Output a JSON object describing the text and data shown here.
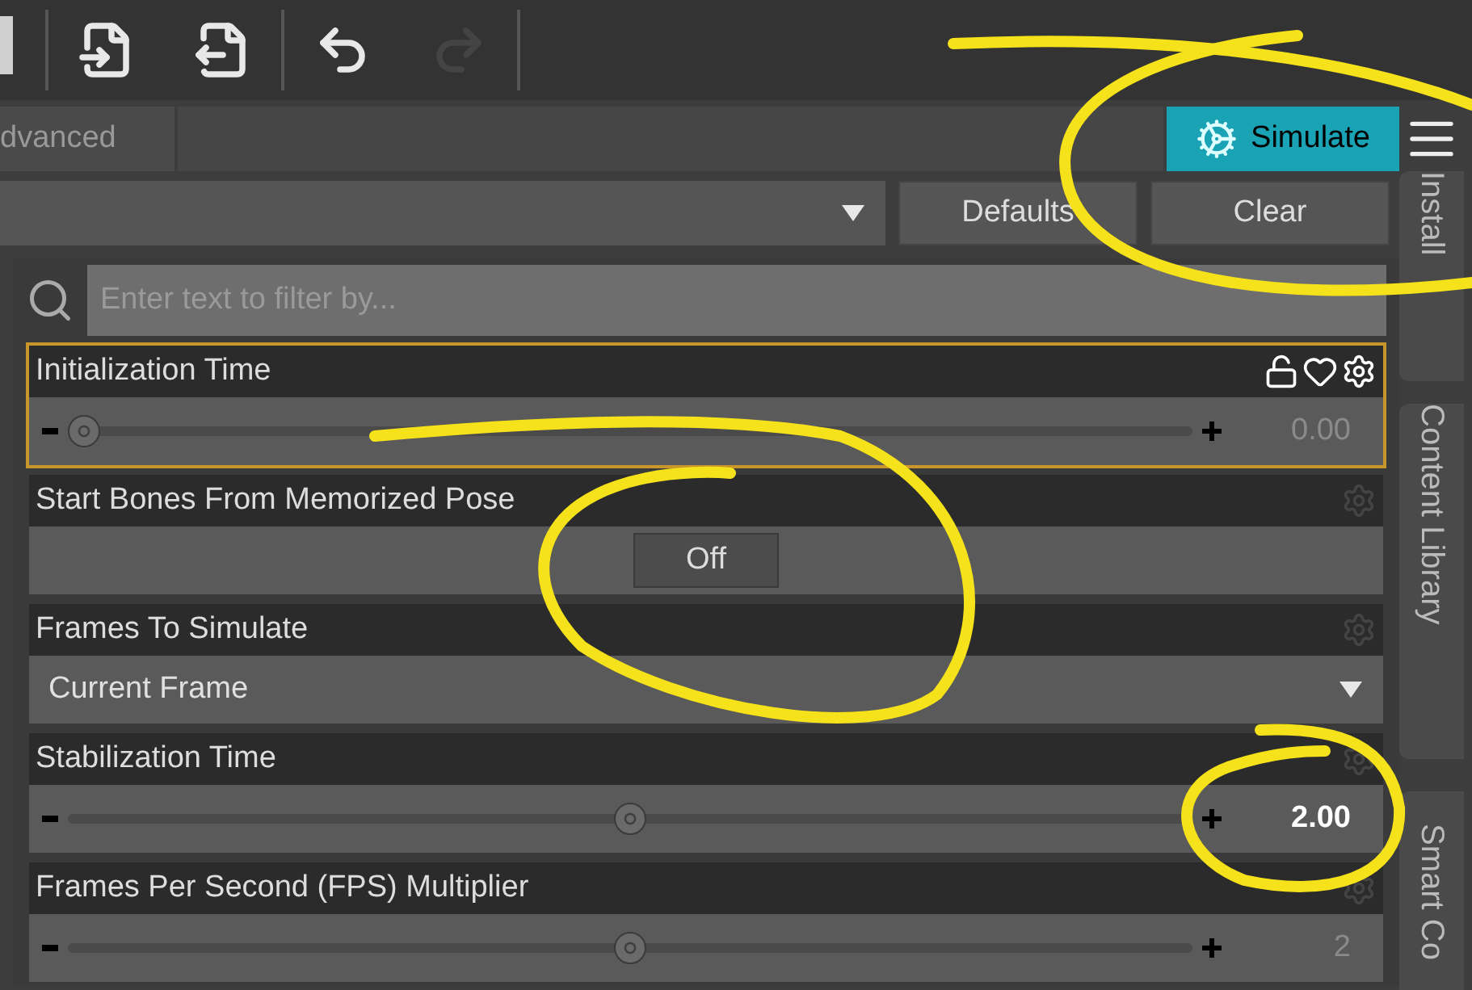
{
  "toolbar": [
    {
      "kind": "import",
      "disabled": false
    },
    {
      "kind": "export",
      "disabled": false
    },
    {
      "kind": "undo",
      "disabled": false
    },
    {
      "kind": "redo",
      "disabled": true
    }
  ],
  "tab": {
    "label": "dvanced"
  },
  "simulate_button": {
    "label": "Simulate"
  },
  "buttons": [
    "Defaults",
    "Clear"
  ],
  "search": {
    "placeholder": "Enter text to filter by..."
  },
  "params": [
    {
      "kind": "slider",
      "label": "Initialization Time",
      "selected": true,
      "level": 0,
      "value": "0.00",
      "modified": false
    },
    {
      "kind": "toggle",
      "label": "Start Bones From Memorized Pose",
      "selected": false,
      "on": false,
      "value": "Off"
    },
    {
      "kind": "dropdown",
      "label": "Frames To Simulate",
      "selected": false,
      "value": "Current Frame"
    },
    {
      "kind": "slider",
      "label": "Stabilization Time",
      "selected": false,
      "level": 0.5,
      "value": "2.00",
      "modified": true
    },
    {
      "kind": "slider",
      "label": "Frames Per Second (FPS) Multiplier",
      "selected": false,
      "level": 0.5,
      "value": "2",
      "modified": false
    }
  ],
  "side_tabs": [
    {
      "label": "Install"
    },
    {
      "label": "Content Library"
    },
    {
      "label": "Smart Co"
    }
  ]
}
